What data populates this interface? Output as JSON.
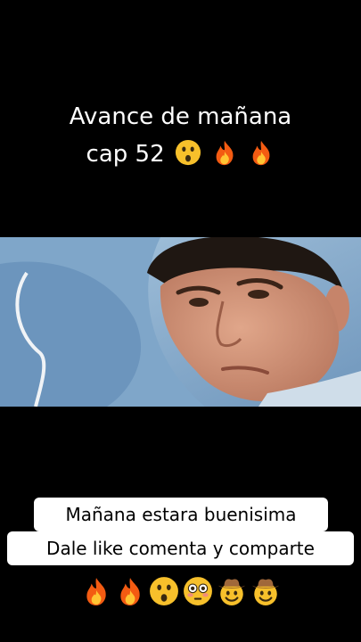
{
  "overlay": {
    "title_line1": "Avance de mañana",
    "title_line2": "cap 52",
    "title_emojis": [
      "astonished-face",
      "fire",
      "fire"
    ]
  },
  "captions": {
    "line1": "Mañana estara buenisima",
    "line2": "Dale like comenta y comparte"
  },
  "emoji_row": [
    "fire",
    "fire",
    "astonished-face",
    "flushed-face",
    "cowboy-face",
    "cowboy-face"
  ],
  "colors": {
    "background": "#000000",
    "text": "#ffffff",
    "caption_bg": "#ffffff",
    "caption_text": "#000000"
  }
}
